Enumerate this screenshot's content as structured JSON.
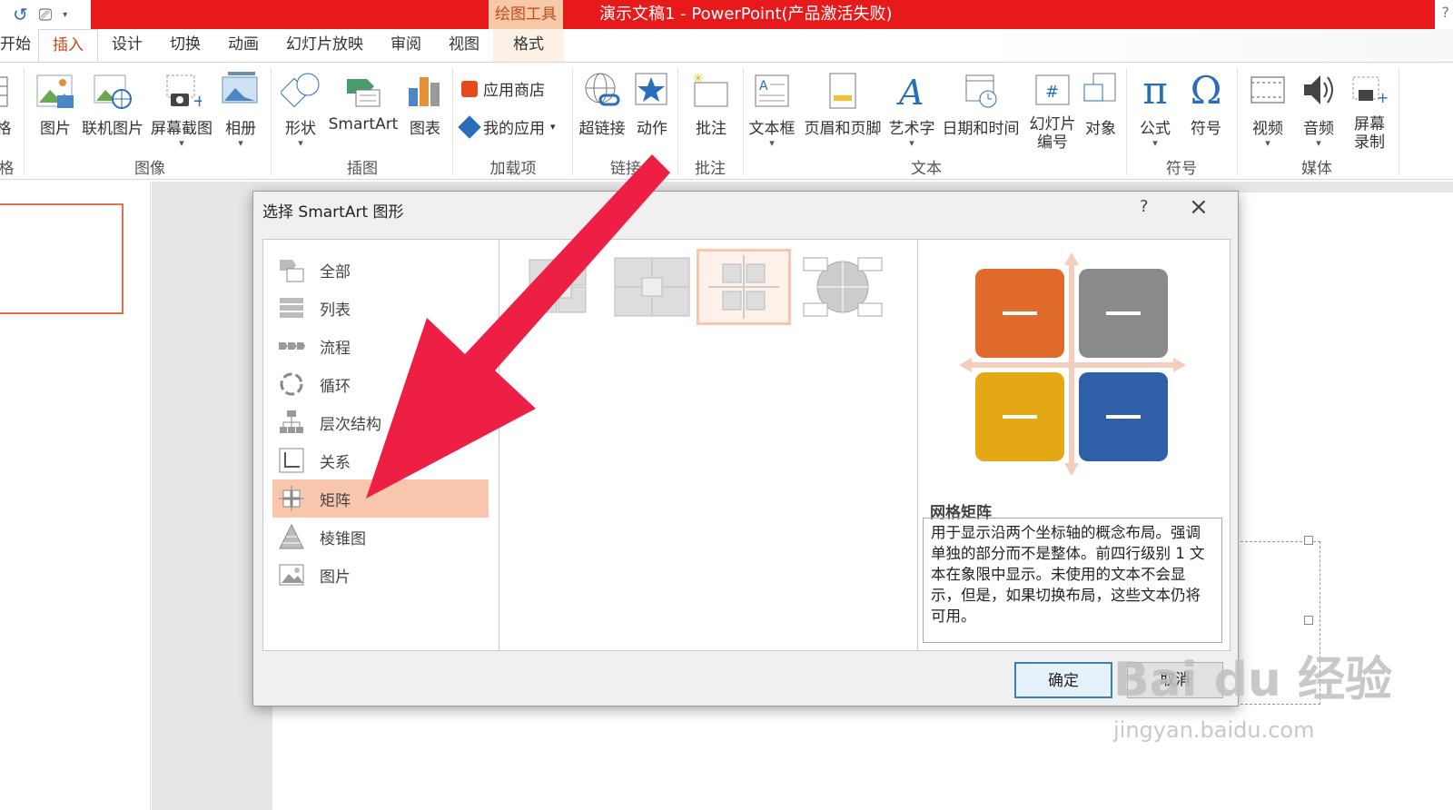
{
  "titlebar": {
    "drawing_tools": "绘图工具",
    "title": "演示文稿1 -  PowerPoint(产品激活失败)",
    "help": "?"
  },
  "tabs": [
    "开始",
    "插入",
    "设计",
    "切换",
    "动画",
    "幻灯片放映",
    "审阅",
    "视图",
    "格式"
  ],
  "ribbon": {
    "buttons": {
      "picture": "图片",
      "online_picture": "联机图片",
      "screenshot": "屏幕截图",
      "album": "相册",
      "shapes": "形状",
      "smartart": "SmartArt",
      "chart": "图表",
      "store": "应用商店",
      "my_apps": "我的应用",
      "hyperlink": "超链接",
      "action": "动作",
      "comment": "批注",
      "textbox": "文本框",
      "header_footer": "页眉和页脚",
      "wordart": "艺术字",
      "datetime": "日期和时间",
      "slide_number_1": "幻灯片",
      "slide_number_2": "编号",
      "object": "对象",
      "equation": "公式",
      "symbol": "符号",
      "video": "视频",
      "audio": "音频",
      "screen_rec_1": "屏幕",
      "screen_rec_2": "录制",
      "left_cut": "格"
    },
    "groups": {
      "images": "图像",
      "illustrations": "插图",
      "addins": "加载项",
      "links": "链接",
      "comments": "批注",
      "text": "文本",
      "symbols": "符号",
      "media": "媒体",
      "left_cut": "格"
    }
  },
  "dialog": {
    "title": "选择 SmartArt 图形",
    "help": "?",
    "categories": [
      {
        "label": "全部",
        "icon": "all-icon"
      },
      {
        "label": "列表",
        "icon": "list-icon"
      },
      {
        "label": "流程",
        "icon": "process-icon"
      },
      {
        "label": "循环",
        "icon": "cycle-icon"
      },
      {
        "label": "层次结构",
        "icon": "hierarchy-icon"
      },
      {
        "label": "关系",
        "icon": "relationship-icon"
      },
      {
        "label": "矩阵",
        "icon": "matrix-icon"
      },
      {
        "label": "棱锥图",
        "icon": "pyramid-icon"
      },
      {
        "label": "图片",
        "icon": "picture-icon"
      }
    ],
    "selected_category": "矩阵",
    "preview": {
      "title": "网格矩阵",
      "description": "用于显示沿两个坐标轴的概念布局。强调单独的部分而不是整体。前四行级别 1 文本在象限中显示。未使用的文本不会显示，但是，如果切换布局，这些文本仍将可用。",
      "colors": [
        "#e06b2c",
        "#8a8a8a",
        "#e3a814",
        "#2f5fa7"
      ]
    },
    "ok": "确定",
    "cancel": "取消"
  },
  "watermark": {
    "brand": "Bai du 经验",
    "url": "jingyan.baidu.com"
  },
  "accent": "#c34a17",
  "arrow_color": "#ee1f45"
}
